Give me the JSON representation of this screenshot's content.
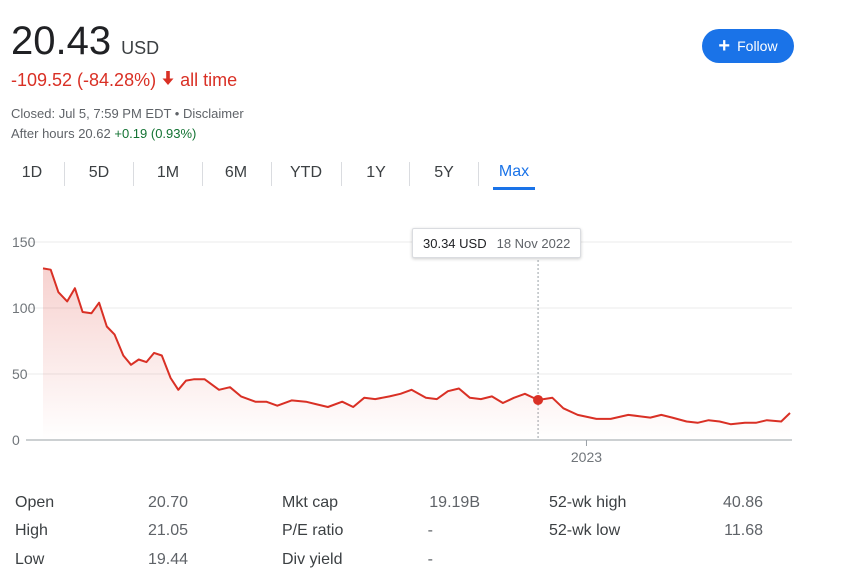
{
  "quote": {
    "price": "20.43",
    "currency": "USD",
    "change": "-109.52 (-84.28%)",
    "change_period": "all time",
    "closed_text": "Closed: Jul 5, 7:59 PM EDT",
    "separator": "•",
    "disclaimer": "Disclaimer",
    "after_hours_label": "After hours 20.62",
    "after_hours_change": "+0.19 (0.93%)",
    "down_color": "#d93025",
    "up_color": "#137333"
  },
  "follow_button": {
    "icon": "plus-icon",
    "label": "Follow",
    "color": "#1a73e8"
  },
  "tabs": [
    "1D",
    "5D",
    "1M",
    "6M",
    "YTD",
    "1Y",
    "5Y",
    "Max"
  ],
  "active_tab": "Max",
  "tooltip": {
    "value": "30.34 USD",
    "date": "18 Nov 2022"
  },
  "chart_data": {
    "type": "line",
    "ylim": [
      0,
      150
    ],
    "y_ticks": [
      "150",
      "100",
      "50",
      "0"
    ],
    "x_tick_labels": [
      "2023"
    ],
    "x_start": "2021-08-25",
    "x_end": "2023-07-05",
    "x_ticks": [
      "2023-01-01"
    ],
    "line_color": "#d93025",
    "series": [
      {
        "x": [
          "2021-08-25",
          "2021-09-01",
          "2021-09-08",
          "2021-09-16",
          "2021-09-23",
          "2021-09-30",
          "2021-10-08",
          "2021-10-15",
          "2021-10-22",
          "2021-10-29",
          "2021-11-06",
          "2021-11-13",
          "2021-11-20",
          "2021-11-27",
          "2021-12-04",
          "2021-12-11",
          "2021-12-19",
          "2021-12-26",
          "2022-01-02",
          "2022-01-09",
          "2022-01-19",
          "2022-02-01",
          "2022-02-11",
          "2022-02-21",
          "2022-03-06",
          "2022-03-16",
          "2022-03-26",
          "2022-04-08",
          "2022-04-21",
          "2022-05-01",
          "2022-05-11",
          "2022-05-24",
          "2022-06-03",
          "2022-06-13",
          "2022-06-23",
          "2022-07-06",
          "2022-07-16",
          "2022-07-26",
          "2022-08-08",
          "2022-08-18",
          "2022-08-28",
          "2022-09-07",
          "2022-09-17",
          "2022-09-27",
          "2022-10-07",
          "2022-10-17",
          "2022-10-27",
          "2022-11-06",
          "2022-11-18",
          "2022-12-01",
          "2022-12-11",
          "2022-12-24",
          "2023-01-10",
          "2023-01-23",
          "2023-02-08",
          "2023-02-18",
          "2023-02-28",
          "2023-03-10",
          "2023-03-20",
          "2023-04-02",
          "2023-04-12",
          "2023-04-22",
          "2023-05-02",
          "2023-05-12",
          "2023-05-25",
          "2023-06-04",
          "2023-06-14",
          "2023-06-27",
          "2023-07-05"
        ],
        "y": [
          130,
          129,
          112,
          105,
          115,
          97,
          96,
          104,
          86,
          80,
          64,
          57,
          61,
          59,
          66,
          64,
          47,
          38,
          45,
          46,
          46,
          38,
          40,
          33,
          29,
          29,
          26,
          30,
          29,
          27,
          25,
          29,
          25,
          32,
          31,
          33,
          35,
          38,
          32,
          31,
          37,
          39,
          32,
          31,
          33,
          28,
          32,
          35,
          30.34,
          32,
          24,
          19,
          16,
          16,
          19,
          18,
          17,
          19,
          17,
          14,
          13,
          15,
          14,
          12,
          13,
          13,
          15,
          14,
          20.43
        ]
      }
    ]
  },
  "stats": [
    {
      "label": "Open",
      "value": "20.70"
    },
    {
      "label": "High",
      "value": "21.05"
    },
    {
      "label": "Low",
      "value": "19.44"
    },
    {
      "label": "Mkt cap",
      "value": "19.19B"
    },
    {
      "label": "P/E ratio",
      "value": "-"
    },
    {
      "label": "Div yield",
      "value": "-"
    },
    {
      "label": "52-wk high",
      "value": "40.86"
    },
    {
      "label": "52-wk low",
      "value": "11.68"
    }
  ]
}
